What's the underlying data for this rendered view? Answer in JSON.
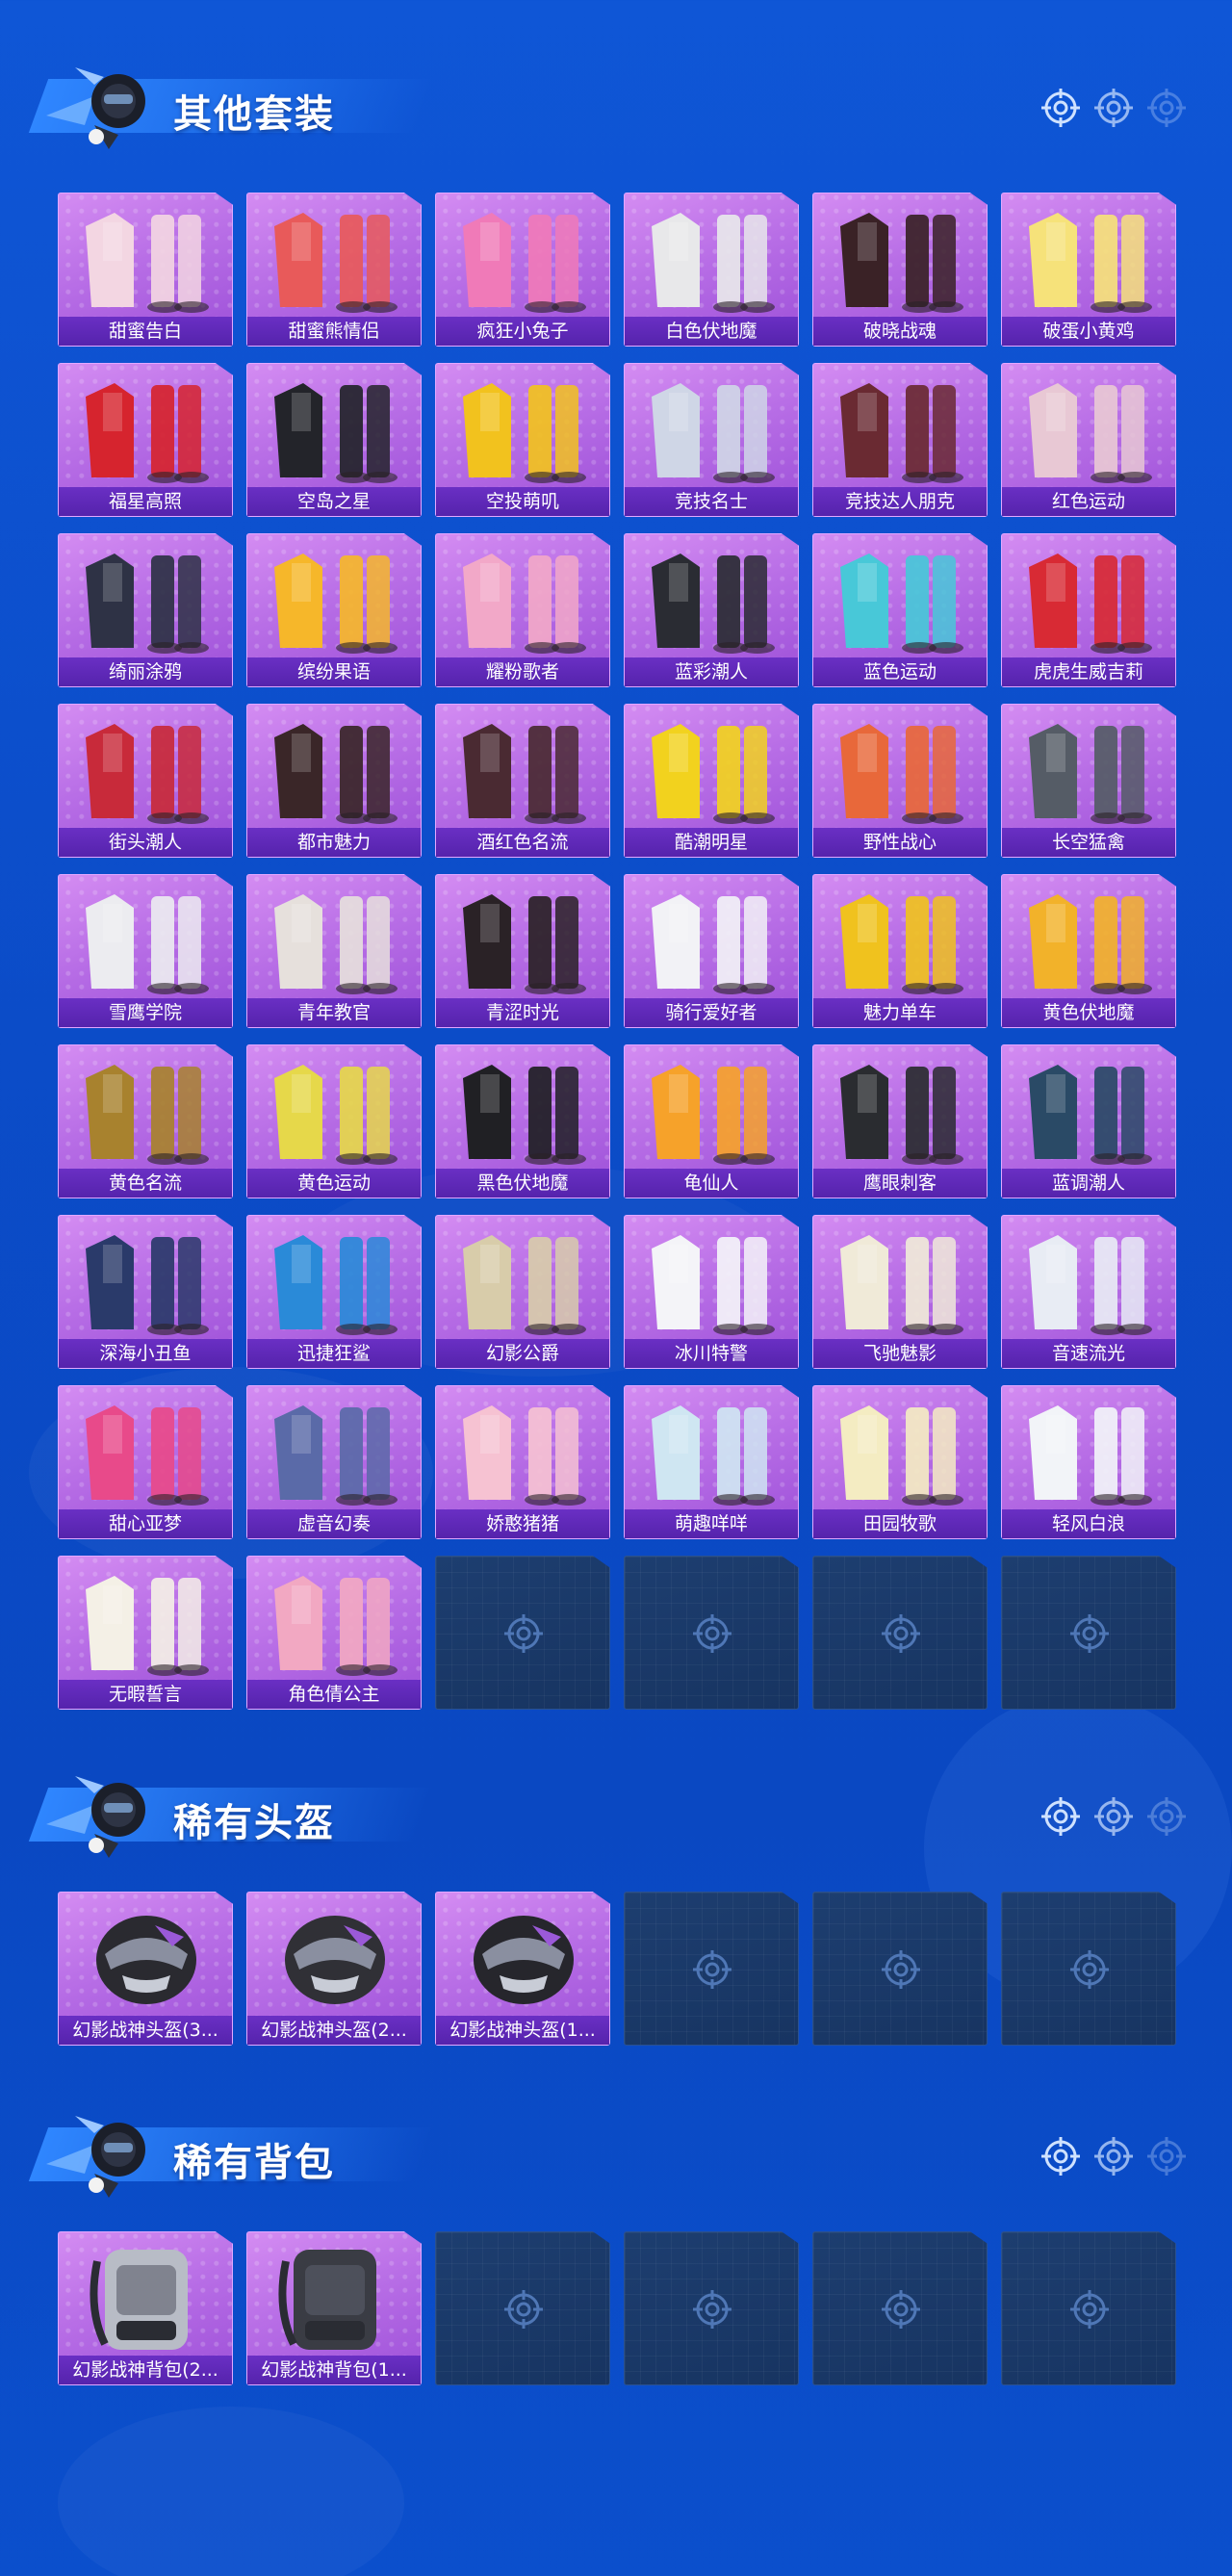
{
  "sections": [
    {
      "title": "其他套装",
      "items": [
        {
          "name": "甜蜜告白",
          "color": "#f3d6e2"
        },
        {
          "name": "甜蜜熊情侣",
          "color": "#e85a5a"
        },
        {
          "name": "疯狂小兔子",
          "color": "#f07ab8"
        },
        {
          "name": "白色伏地魔",
          "color": "#e8e8ea"
        },
        {
          "name": "破晓战魂",
          "color": "#3a2226"
        },
        {
          "name": "破蛋小黄鸡",
          "color": "#f6e27a"
        },
        {
          "name": "福星高照",
          "color": "#d6242e"
        },
        {
          "name": "空岛之星",
          "color": "#23242a"
        },
        {
          "name": "空投萌叽",
          "color": "#f2c21e"
        },
        {
          "name": "竞技名士",
          "color": "#cfd6e6"
        },
        {
          "name": "竞技达人朋克",
          "color": "#6a2a32"
        },
        {
          "name": "红色运动",
          "color": "#e8c8d4"
        },
        {
          "name": "绮丽涂鸦",
          "color": "#2e3245"
        },
        {
          "name": "缤纷果语",
          "color": "#f6b72a"
        },
        {
          "name": "耀粉歌者",
          "color": "#f2a8c8"
        },
        {
          "name": "蓝彩潮人",
          "color": "#2a2c33"
        },
        {
          "name": "蓝色运动",
          "color": "#48c8d8"
        },
        {
          "name": "虎虎生威吉莉",
          "color": "#d82a34"
        },
        {
          "name": "街头潮人",
          "color": "#c82a3a"
        },
        {
          "name": "都市魅力",
          "color": "#3a2628"
        },
        {
          "name": "酒红色名流",
          "color": "#4a2a32"
        },
        {
          "name": "酷潮明星",
          "color": "#f2d21e"
        },
        {
          "name": "野性战心",
          "color": "#e8683a"
        },
        {
          "name": "长空猛禽",
          "color": "#555c66"
        },
        {
          "name": "雪鹰学院",
          "color": "#ececf0"
        },
        {
          "name": "青年教官",
          "color": "#e6e0dc"
        },
        {
          "name": "青涩时光",
          "color": "#2a2226"
        },
        {
          "name": "骑行爱好者",
          "color": "#f2f2f6"
        },
        {
          "name": "魅力单车",
          "color": "#f0c21e"
        },
        {
          "name": "黄色伏地魔",
          "color": "#f2b22a"
        },
        {
          "name": "黄色名流",
          "color": "#a8822e"
        },
        {
          "name": "黄色运动",
          "color": "#e6d84a"
        },
        {
          "name": "黑色伏地魔",
          "color": "#202024"
        },
        {
          "name": "龟仙人",
          "color": "#f6a22a"
        },
        {
          "name": "鹰眼刺客",
          "color": "#2a2c30"
        },
        {
          "name": "蓝调潮人",
          "color": "#2a4a66"
        },
        {
          "name": "深海小丑鱼",
          "color": "#2a3a6a"
        },
        {
          "name": "迅捷狂鲨",
          "color": "#2a8ad8"
        },
        {
          "name": "幻影公爵",
          "color": "#d8ccaa"
        },
        {
          "name": "冰川特警",
          "color": "#f4f4f8"
        },
        {
          "name": "飞驰魅影",
          "color": "#f0ead8"
        },
        {
          "name": "音速流光",
          "color": "#e8ecf4"
        },
        {
          "name": "甜心亚梦",
          "color": "#e84a8a"
        },
        {
          "name": "虚音幻奏",
          "color": "#5a6aa8"
        },
        {
          "name": "娇憨猪猪",
          "color": "#f6c2d2"
        },
        {
          "name": "萌趣咩咩",
          "color": "#cfe6f2"
        },
        {
          "name": "田园牧歌",
          "color": "#f4ecc2"
        },
        {
          "name": "轻风白浪",
          "color": "#f2f4f8"
        },
        {
          "name": "无暇誓言",
          "color": "#f4f0e6"
        },
        {
          "name": "角色倩公主",
          "color": "#f2a8c2"
        }
      ],
      "empty_count": 4
    },
    {
      "title": "稀有头盔",
      "items": [
        {
          "name": "幻影战神头盔(3...",
          "color": "#2a2a30"
        },
        {
          "name": "幻影战神头盔(2...",
          "color": "#303036"
        },
        {
          "name": "幻影战神头盔(1...",
          "color": "#26262c"
        }
      ],
      "empty_count": 3
    },
    {
      "title": "稀有背包",
      "items": [
        {
          "name": "幻影战神背包(2...",
          "color": "#b8bcc6"
        },
        {
          "name": "幻影战神背包(1...",
          "color": "#3a3c44"
        }
      ],
      "empty_count": 4
    }
  ]
}
